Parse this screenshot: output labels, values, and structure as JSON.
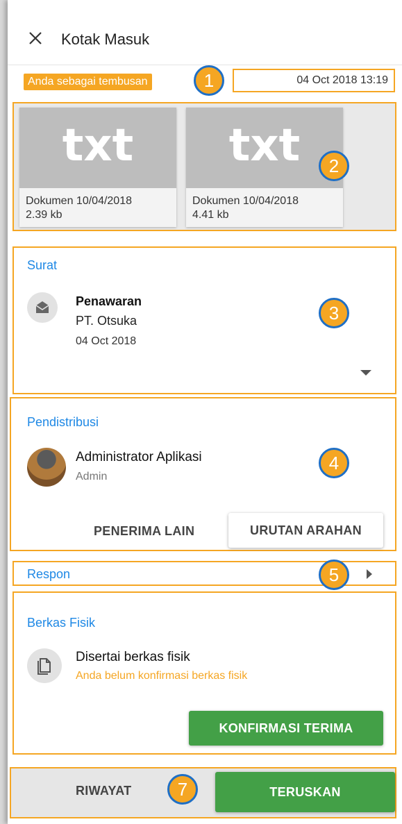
{
  "header": {
    "title": "Kotak Masuk",
    "close_icon": "close-icon"
  },
  "meta": {
    "badge": "Anda sebagai tembusan",
    "datetime": "04 Oct 2018 13:19"
  },
  "markers": [
    "1",
    "2",
    "3",
    "4",
    "5",
    "7"
  ],
  "attachments": [
    {
      "thumb": "txt",
      "name": "Dokumen 10/04/2018",
      "size": "2.39 kb"
    },
    {
      "thumb": "txt",
      "name": "Dokumen 10/04/2018",
      "size": "4.41 kb"
    }
  ],
  "surat": {
    "title": "Surat",
    "subject": "Penawaran",
    "sender": "PT. Otsuka",
    "date": "04 Oct 2018",
    "icon": "mail-open-icon"
  },
  "pendistribusi": {
    "title": "Pendistribusi",
    "name": "Administrator Aplikasi",
    "role": "Admin",
    "btn_other": "PENERIMA LAIN",
    "btn_order": "URUTAN ARAHAN"
  },
  "respon": {
    "title": "Respon"
  },
  "berkas": {
    "title": "Berkas Fisik",
    "label": "Disertai berkas fisik",
    "status": "Anda belum konfirmasi berkas fisik",
    "btn_confirm": "KONFIRMASI TERIMA",
    "icon": "document-icon"
  },
  "footer": {
    "history": "RIWAYAT",
    "forward": "TERUSKAN"
  },
  "colors": {
    "accent_orange": "#f5a623",
    "link_blue": "#1e88e5",
    "green": "#43a047",
    "marker_border": "#1f6fc5"
  }
}
